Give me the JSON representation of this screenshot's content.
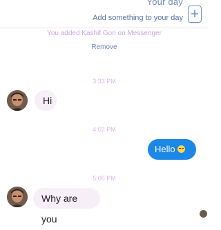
{
  "story": {
    "title": "Your day",
    "subtitle": "Add something to your day",
    "add_icon": "add-story-icon"
  },
  "notice": {
    "text": "You added Kashif Gori on Messenger",
    "action": "Remove"
  },
  "messages": [
    {
      "timestamp": "3:33 PM",
      "direction": "incoming",
      "text": "Hi"
    },
    {
      "timestamp": "4:02 PM",
      "direction": "outgoing",
      "text": "Hello",
      "emoji": "sweat-smile-emoji"
    },
    {
      "timestamp": "5:05 PM",
      "direction": "incoming",
      "text": "Why are you"
    }
  ],
  "colors": {
    "sent_bubble": "#1b87e6",
    "received_bubble": "#f6eff8",
    "timestamp": "#dcb7ea",
    "notice": "#c9a6e0",
    "link": "#6f86b9"
  }
}
